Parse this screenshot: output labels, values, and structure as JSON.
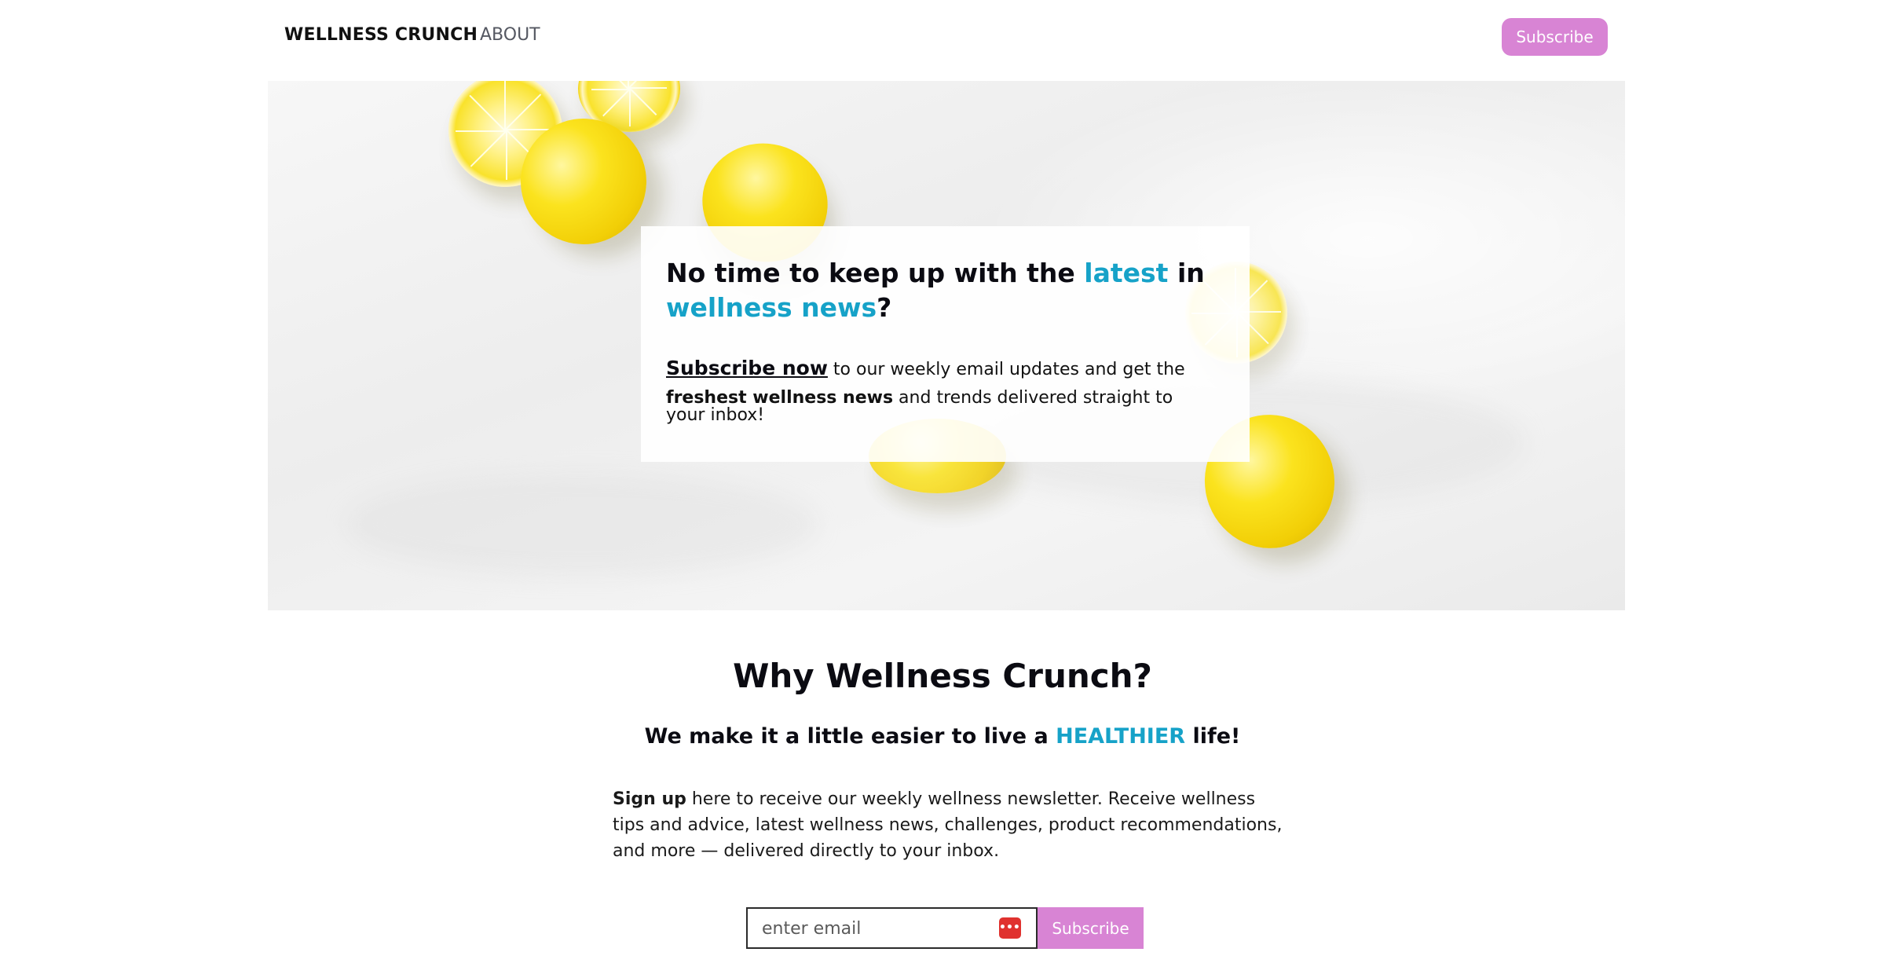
{
  "nav": {
    "brand": "WELLNESS CRUNCH",
    "about": "ABOUT",
    "subscribe_label": "Subscribe"
  },
  "hero": {
    "title_part1": "No time to keep up with the ",
    "title_accent1": "latest",
    "title_part2": " in ",
    "title_accent2": "wellness news",
    "title_part3": "?",
    "cta": "Subscribe now",
    "text_part1": " to our weekly email updates and get the",
    "text_bold": "freshest wellness news",
    "text_part2": " and trends delivered straight to your inbox!"
  },
  "why": {
    "title": "Why Wellness Crunch?",
    "sub_part1": "We make it a little easier to live a ",
    "sub_accent": "HEALTHIER",
    "sub_part2": " life!",
    "body_bold": "Sign up",
    "body_text": " here to receive our weekly wellness newsletter. Receive wellness tips and advice, latest wellness news, challenges, product recommendations, and more — delivered directly to your inbox."
  },
  "form": {
    "email_placeholder": "enter email",
    "email_value": "",
    "password_manager_icon": "•••|",
    "subscribe_label": "Subscribe"
  },
  "colors": {
    "accent": "#16a2c8",
    "button": "#d884d4",
    "pw_icon": "#e0322f"
  },
  "icons": {
    "password_manager": "password-manager-icon"
  }
}
